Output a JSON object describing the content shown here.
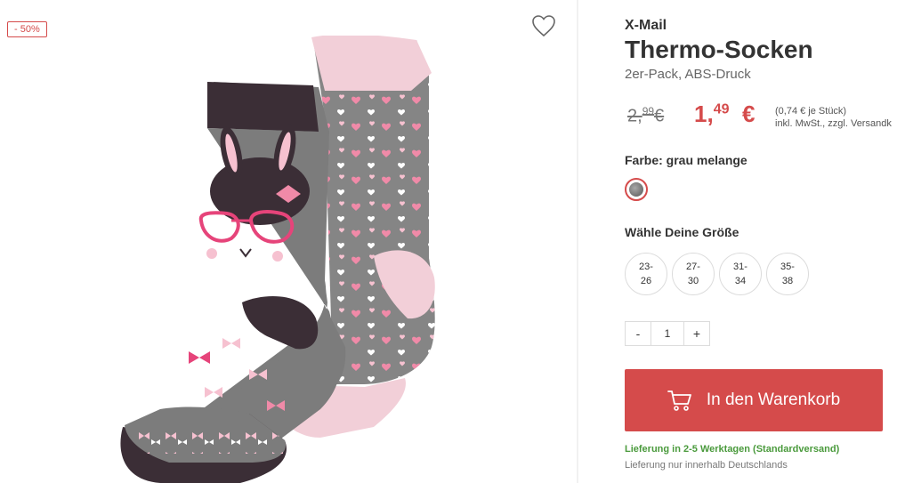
{
  "badge": {
    "discount": "- 50%"
  },
  "icons": {
    "wishlist": "heart-outline-icon",
    "cart": "shopping-cart-icon"
  },
  "product": {
    "brand": "X-Mail",
    "title": "Thermo-Socken",
    "subtitle": "2er-Pack, ABS-Druck"
  },
  "price": {
    "old_main": "2,",
    "old_cents": "99",
    "old_currency": "€",
    "new_main": "1,",
    "new_cents": "49",
    "new_currency": "€",
    "unit_line1": "(0,74 € je Stück)",
    "unit_line2": "inkl. MwSt., zzgl. Versandk"
  },
  "color": {
    "label": "Farbe: grau melange"
  },
  "sizes": {
    "label": "Wähle Deine Größe",
    "options": [
      {
        "line1": "23-",
        "line2": "26"
      },
      {
        "line1": "27-",
        "line2": "30"
      },
      {
        "line1": "31-",
        "line2": "34"
      },
      {
        "line1": "35-",
        "line2": "38"
      }
    ]
  },
  "quantity": {
    "minus": "-",
    "value": "1",
    "plus": "+"
  },
  "cart": {
    "label": "In den Warenkorb"
  },
  "delivery": {
    "info": "Lieferung in 2-5 Werktagen (Standardversand)",
    "note": "Lieferung nur innerhalb Deutschlands"
  },
  "colors": {
    "accent": "#d54b4b",
    "success": "#4a9a3c",
    "sock_gray": "#7c7c7c",
    "sock_pink": "#f2cfd8",
    "sock_dark": "#3b2e36"
  }
}
